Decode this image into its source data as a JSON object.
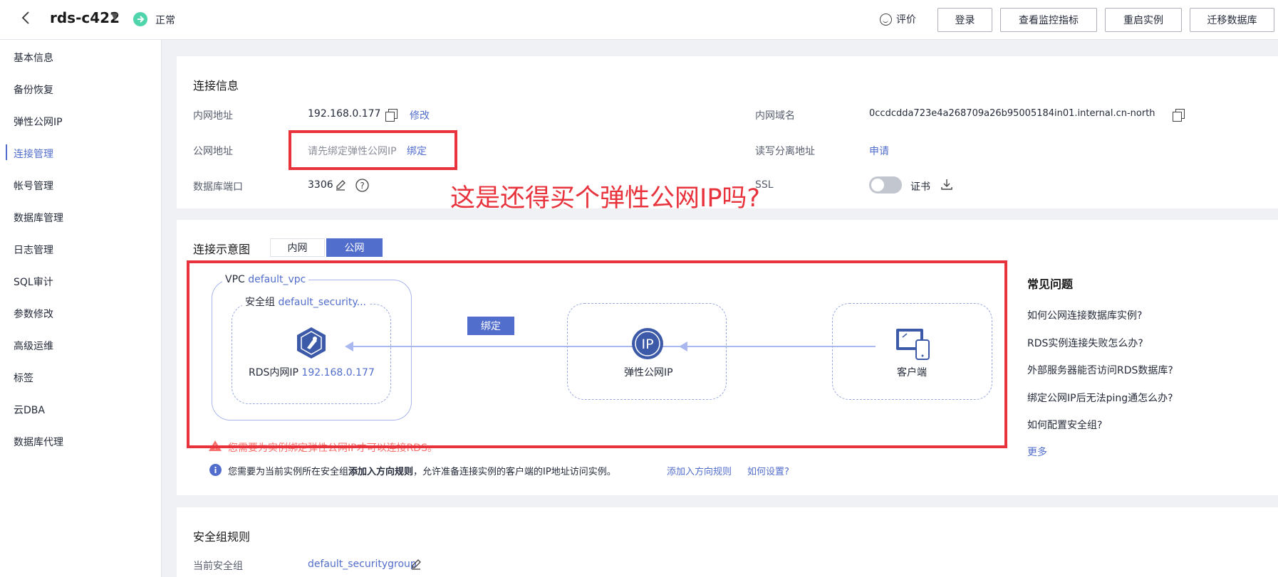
{
  "header": {
    "title": "rds-c422",
    "status": "正常",
    "rate": "评价",
    "buttons": {
      "login": "登录",
      "monitor": "查看监控指标",
      "restart": "重启实例",
      "migrate": "迁移数据库"
    }
  },
  "sidebar": {
    "items": [
      {
        "label": "基本信息"
      },
      {
        "label": "备份恢复"
      },
      {
        "label": "弹性公网IP"
      },
      {
        "label": "连接管理"
      },
      {
        "label": "帐号管理"
      },
      {
        "label": "数据库管理"
      },
      {
        "label": "日志管理"
      },
      {
        "label": "SQL审计"
      },
      {
        "label": "参数修改"
      },
      {
        "label": "高级运维"
      },
      {
        "label": "标签"
      },
      {
        "label": "云DBA"
      },
      {
        "label": "数据库代理"
      }
    ],
    "active_index": 3
  },
  "conn": {
    "title": "连接信息",
    "private_addr_label": "内网地址",
    "private_addr": "192.168.0.177",
    "modify": "修改",
    "public_addr_label": "公网地址",
    "public_addr_hint": "请先绑定弹性公网IP",
    "bind": "绑定",
    "port_label": "数据库端口",
    "port": "3306",
    "domain_label": "内网域名",
    "domain": "0ccdcdda723e4a268709a26b95005184in01.internal.cn-north...",
    "rw_label": "读写分离地址",
    "rw_apply": "申请",
    "ssl_label": "SSL",
    "cert": "证书"
  },
  "annotation": "这是还得买个弹性公网IP吗?",
  "diagram": {
    "title": "连接示意图",
    "tab_private": "内网",
    "tab_public": "公网",
    "vpc_label": "VPC",
    "vpc_name": "default_vpc",
    "sg_label": "安全组",
    "sg_name": "default_security...",
    "rds_label": "RDS内网IP",
    "rds_ip": "192.168.0.177",
    "bind_chip": "绑定",
    "eip_label": "弹性公网IP",
    "eip_icon_text": "IP",
    "client_label": "客户端",
    "warning": "您需要为实例绑定弹性公网IP才可以连接RDS。",
    "info_pre": "您需要为当前实例所在安全组",
    "info_bold": "添加入方向规则",
    "info_post": "，允许准备连接实例的客户端的IP地址访问实例。",
    "add_rule": "添加入方向规则",
    "how": "如何设置?"
  },
  "faq": {
    "title": "常见问题",
    "items": [
      "如何公网连接数据库实例?",
      "RDS实例连接失败怎么办?",
      "外部服务器能否访问RDS数据库?",
      "绑定公网IP后无法ping通怎么办?",
      "如何配置安全组?"
    ],
    "more": "更多"
  },
  "sg": {
    "title": "安全组规则",
    "current_label": "当前安全组",
    "current": "default_securitygroup"
  },
  "colors": {
    "accent": "#526ecc",
    "annotation": "#e8333d",
    "status_ok": "#50d4ab",
    "warning": "#f66f6a"
  }
}
